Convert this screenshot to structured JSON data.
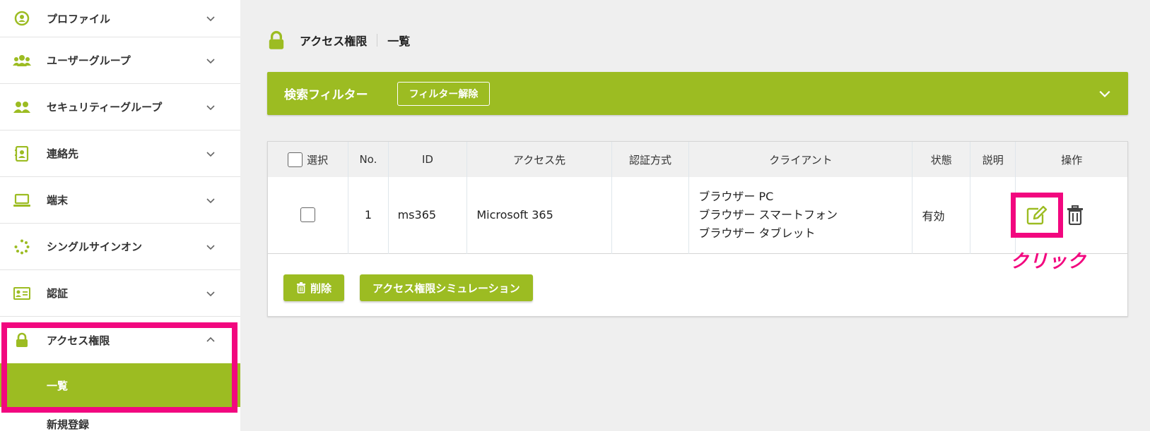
{
  "sidebar": {
    "items": [
      {
        "label": "プロファイル",
        "icon": "profile-icon"
      },
      {
        "label": "ユーザーグループ",
        "icon": "users-icon"
      },
      {
        "label": "セキュリティーグループ",
        "icon": "user-group-icon"
      },
      {
        "label": "連絡先",
        "icon": "contact-icon"
      },
      {
        "label": "端末",
        "icon": "laptop-icon"
      },
      {
        "label": "シングルサインオン",
        "icon": "spinner-icon"
      },
      {
        "label": "認証",
        "icon": "id-card-icon"
      },
      {
        "label": "アクセス権限",
        "icon": "lock-icon"
      }
    ],
    "sub_items": [
      {
        "label": "一覧"
      },
      {
        "label": "新規登録"
      }
    ]
  },
  "breadcrumb": {
    "section": "アクセス権限",
    "page": "一覧"
  },
  "filter": {
    "title": "検索フィルター",
    "clear_label": "フィルター解除"
  },
  "table": {
    "headers": {
      "select": "選択",
      "no": "No.",
      "id": "ID",
      "target": "アクセス先",
      "auth": "認証方式",
      "client": "クライアント",
      "status": "状態",
      "description": "説明",
      "ops": "操作"
    },
    "rows": [
      {
        "no": "1",
        "id": "ms365",
        "target": "Microsoft 365",
        "auth": "",
        "client": [
          "ブラウザー PC",
          "ブラウザー スマートフォン",
          "ブラウザー タブレット"
        ],
        "status": "有効",
        "description": ""
      }
    ]
  },
  "actions": {
    "delete_label": "削除",
    "simulation_label": "アクセス権限シミュレーション"
  },
  "annotation": {
    "text": "クリック"
  },
  "colors": {
    "accent": "#9cbc22",
    "highlight": "#f2077f"
  }
}
